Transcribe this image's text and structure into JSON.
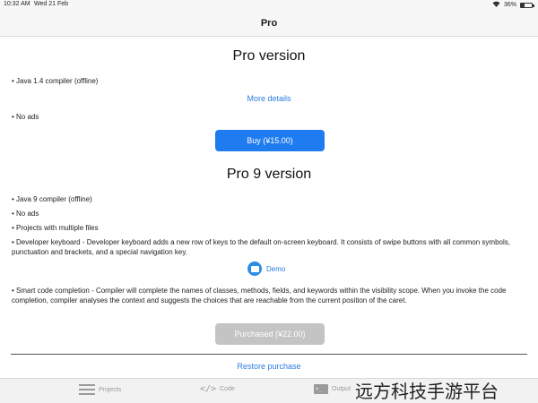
{
  "status_bar": {
    "time": "10:32 AM",
    "date": "Wed 21 Feb",
    "battery": "36%",
    "battery_level": 0.36
  },
  "nav": {
    "title": "Pro"
  },
  "pro_section": {
    "title": "Pro version",
    "features": [
      "• Java 1.4 compiler (offline)",
      "• No ads"
    ],
    "more_details": "More details",
    "buy_label": "Buy  (¥15.00)"
  },
  "pro9_section": {
    "title": "Pro 9 version",
    "features": [
      "• Java 9 compiler (offline)",
      "• No ads",
      "• Projects with multiple files",
      "• Developer keyboard - Developer keyboard adds a new row of keys to the default on-screen keyboard. It consists of swipe buttons with all common symbols, punctuation and brackets, and a special navigation key.",
      "• Smart code completion - Compiler will complete the names of classes, methods, fields, and keywords within the visibility scope. When you invoke the code completion, compiler analyses the context and suggests the choices that are reachable from the current position of the caret."
    ],
    "demo_label": "Demo",
    "purchased_label": "Purchased  (¥22.00)"
  },
  "restore_label": "Restore purchase",
  "tabs": [
    {
      "label": "Projects",
      "icon": "list-icon"
    },
    {
      "label": "Code",
      "icon": "code-icon"
    },
    {
      "label": "Output",
      "icon": "terminal-icon"
    }
  ],
  "watermark": "远方科技手游平台",
  "colors": {
    "accent": "#1f7bf0",
    "link": "#2b7be4",
    "disabled": "#c4c4c4"
  }
}
